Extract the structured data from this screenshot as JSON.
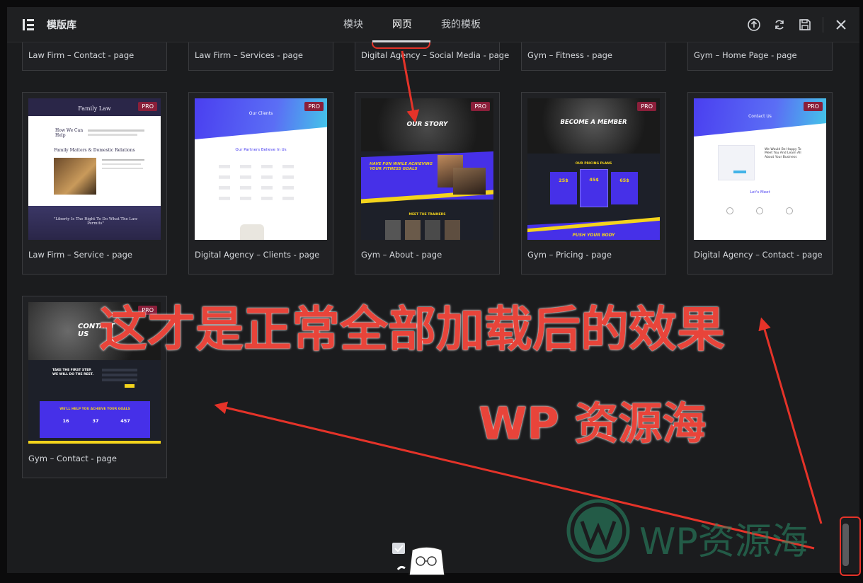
{
  "header": {
    "title": "模版库",
    "tabs": [
      {
        "label": "模块",
        "active": false
      },
      {
        "label": "网页",
        "active": true
      },
      {
        "label": "我的模板",
        "active": false
      }
    ],
    "tools": [
      "upload-icon",
      "sync-icon",
      "save-icon",
      "close-icon"
    ]
  },
  "badge": "PRO",
  "top_row_labels": [
    "Law Firm – Contact - page",
    "Law Firm – Services - page",
    "Digital Agency – Social Media - page",
    "Gym – Fitness - page",
    "Gym – Home Page - page"
  ],
  "row1": [
    {
      "label": "Law Firm – Service - page",
      "pro": true,
      "thumb": {
        "heading": "Family Law",
        "sub": "How We Can Help",
        "section": "Family Matters & Domestic Relations",
        "quote": "\"Liberty Is The Right To Do What The Law Permits\""
      }
    },
    {
      "label": "Digital Agency – Clients - page",
      "pro": true,
      "thumb": {
        "heading": "Our Clients",
        "section": "Our Partners Believe In Us"
      }
    },
    {
      "label": "Gym – About - page",
      "pro": true,
      "thumb": {
        "heading": "OUR STORY",
        "band": "HAVE FUN WHILE ACHIEVING YOUR FITNESS GOALS",
        "section": "MEET THE TRAINERS"
      }
    },
    {
      "label": "Gym – Pricing - page",
      "pro": true,
      "thumb": {
        "heading": "BECOME A MEMBER",
        "section": "OUR PRICING PLANS",
        "prices": [
          "25$",
          "45$",
          "65$"
        ],
        "footer": "PUSH YOUR BODY"
      }
    },
    {
      "label": "Digital Agency – Contact - page",
      "pro": true,
      "thumb": {
        "heading": "Contact Us",
        "sub": "We Would Be Happy To Meet You And Learn All About Your Business",
        "section": "Let's Meet"
      }
    }
  ],
  "row2": [
    {
      "label": "Gym – Contact - page",
      "pro": true,
      "thumb": {
        "heading": "CONTACT US",
        "sub": "TAKE THE FIRST STEP. WE WILL DO THE REST.",
        "band": "WE'LL HELP YOU ACHIEVE YOUR GOALS",
        "stats": [
          "16",
          "37",
          "457"
        ]
      }
    }
  ],
  "annotations": {
    "main": "这才是正常全部加载后的效果",
    "brand": "WP 资源海"
  },
  "watermark": {
    "text": "WP资源海"
  },
  "colors": {
    "annotation": "#e53329",
    "pro_badge": "#8a1f3a",
    "agency_blue": "#4a3ff0",
    "gym_yellow": "#f4d41c",
    "watermark": "#2b8f6a"
  }
}
